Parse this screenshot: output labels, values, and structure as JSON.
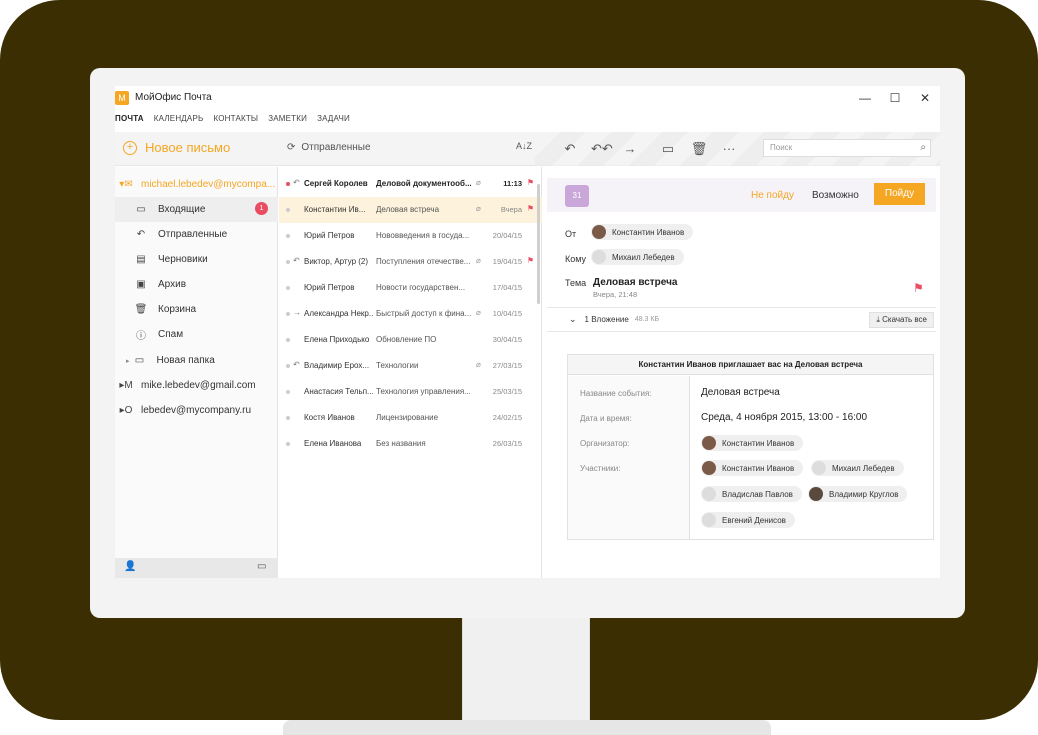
{
  "app": {
    "title": "МойОфис Почта",
    "logo": "M"
  },
  "window_controls": {
    "minimize": "—",
    "maximize": "☐",
    "close": "✕"
  },
  "menu": [
    "ПОЧТА",
    "КАЛЕНДАРЬ",
    "КОНТАКТЫ",
    "ЗАМЕТКИ",
    "ЗАДАЧИ"
  ],
  "toolbar": {
    "new_mail": "Новое письмо",
    "folder_label": "Отправленные",
    "sort": "A↓Z",
    "search_placeholder": "Поиск"
  },
  "sidebar": {
    "account1": "michael.lebedev@mycompa...",
    "folders": [
      {
        "label": "Входящие",
        "badge": "1",
        "icon": "inbox-icon"
      },
      {
        "label": "Отправленные",
        "icon": "sent-icon"
      },
      {
        "label": "Черновики",
        "icon": "drafts-icon"
      },
      {
        "label": "Архив",
        "icon": "archive-icon"
      },
      {
        "label": "Корзина",
        "icon": "trash-icon"
      },
      {
        "label": "Спам",
        "icon": "spam-icon"
      },
      {
        "label": "Новая папка",
        "icon": "folder-icon"
      }
    ],
    "account2": "mike.lebedev@gmail.com",
    "account3": "lebedev@mycompany.ru"
  },
  "messages": [
    {
      "from": "Сергей Королев",
      "subject": "Деловой документооб...",
      "date": "11:13",
      "unread": true,
      "replied": true,
      "attach": true,
      "flag": true
    },
    {
      "from": "Константин Ив...",
      "subject": "Деловая встреча",
      "date": "Вчера",
      "attach": true,
      "flag": true,
      "selected": true
    },
    {
      "from": "Юрий Петров",
      "subject": "Нововведения в госуда...",
      "date": "20/04/15"
    },
    {
      "from": "Виктор, Артур (2)",
      "subject": "Поступления отечестве...",
      "date": "19/04/15",
      "replied": true,
      "attach": true,
      "flag": true
    },
    {
      "from": "Юрий Петров",
      "subject": "Новости государствен...",
      "date": "17/04/15"
    },
    {
      "from": "Александра Некр...",
      "subject": "Быстрый доступ к фина...",
      "date": "10/04/15",
      "forwarded": true,
      "attach": true
    },
    {
      "from": "Елена Приходько",
      "subject": "Обновление ПО",
      "date": "30/04/15"
    },
    {
      "from": "Владимир Ерох...",
      "subject": "Технологии",
      "date": "27/03/15",
      "replied": true,
      "attach": true
    },
    {
      "from": "Анастасия Тельп...",
      "subject": "Технология управления...",
      "date": "25/03/15"
    },
    {
      "from": "Костя Иванов",
      "subject": "Лицензирование",
      "date": "24/02/15"
    },
    {
      "from": "Елена Иванова",
      "subject": "Без названия",
      "date": "26/03/15"
    }
  ],
  "reading": {
    "calendar_day": "31",
    "decline": "Не пойду",
    "maybe": "Возможно",
    "accept": "Пойду",
    "from_label": "От",
    "from": "Константин Иванов",
    "to_label": "Кому",
    "to": "Михаил Лебедев",
    "subject_label": "Тема",
    "subject": "Деловая встреча",
    "date": "Вчера, 21:48",
    "attachments": "1 Вложение",
    "attachments_size": "48.3 КБ",
    "download_all": "Скачать все",
    "invite_title": "Константин Иванов приглашает вас на Деловая встреча",
    "event_label": "Название события:",
    "event": "Деловая встреча",
    "datetime_label": "Дата и время:",
    "datetime": "Среда, 4 ноября 2015, 13:00 - 16:00",
    "organizer_label": "Организатор:",
    "organizer": "Константин Иванов",
    "participants_label": "Участники:",
    "participants": [
      "Константин Иванов",
      "Михаил Лебедев",
      "Владислав Павлов",
      "Владимир Круглов",
      "Евгений Денисов"
    ]
  },
  "colors": {
    "accent": "#f5a623",
    "badge": "#e94d62",
    "bezel": "#3c2e03"
  }
}
